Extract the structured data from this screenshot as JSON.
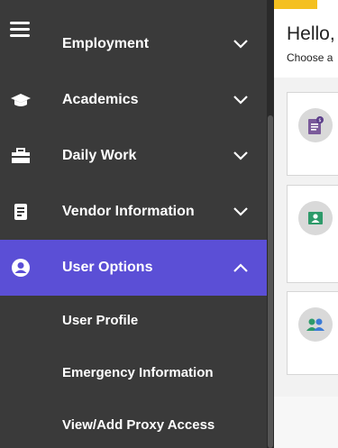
{
  "sidebar": {
    "items": [
      {
        "label": "Employment",
        "icon": "chevron-down-icon"
      },
      {
        "label": "Academics",
        "icon": "graduation-cap-icon"
      },
      {
        "label": "Daily Work",
        "icon": "briefcase-icon"
      },
      {
        "label": "Vendor Information",
        "icon": "vendor-document-icon"
      },
      {
        "label": "User Options",
        "icon": "user-circle-icon",
        "expanded": true
      }
    ],
    "sub_items": [
      {
        "label": "User Profile"
      },
      {
        "label": "Emergency Information"
      },
      {
        "label": "View/Add Proxy Access"
      }
    ]
  },
  "main": {
    "greeting": "Hello,",
    "subtitle": "Choose a"
  },
  "colors": {
    "sidebar_bg": "#3a3a3a",
    "active_bg": "#5b4fd6",
    "accent_tab": "#f4c020"
  }
}
